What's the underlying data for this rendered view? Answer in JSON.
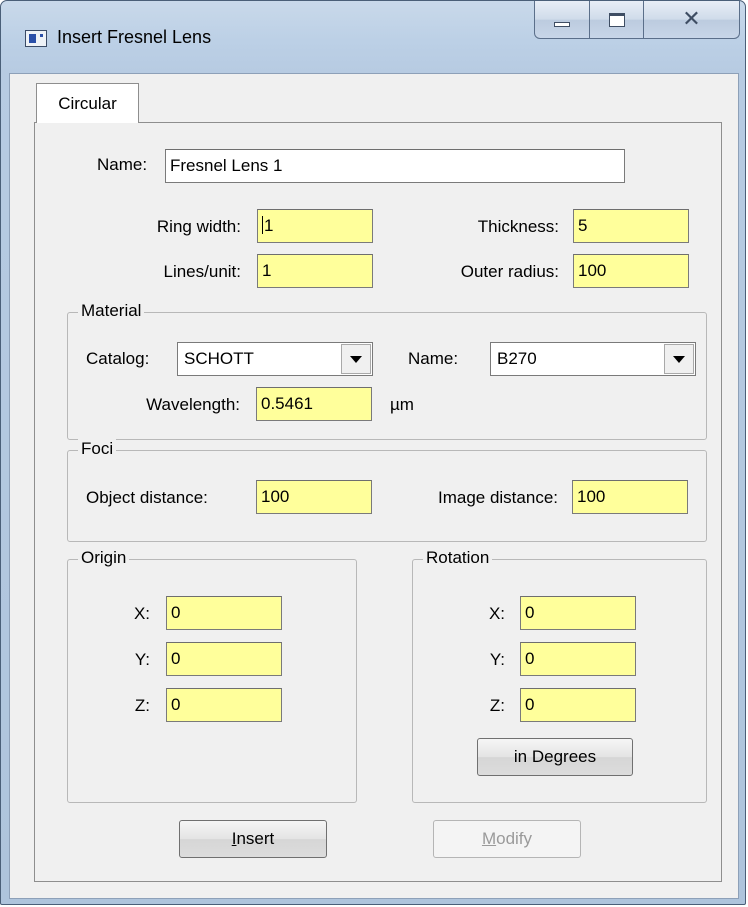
{
  "window": {
    "title": "Insert Fresnel Lens"
  },
  "caption": {
    "minimize_icon": "minimize-icon",
    "maximize_icon": "maximize-icon",
    "close_icon": "close-icon"
  },
  "tabs": [
    {
      "label": "Circular",
      "selected": true
    }
  ],
  "form": {
    "name_label": "Name:",
    "name_value": "Fresnel Lens 1",
    "ring_width_label": "Ring width:",
    "ring_width_value": "1",
    "thickness_label": "Thickness:",
    "thickness_value": "5",
    "lines_unit_label": "Lines/unit:",
    "lines_unit_value": "1",
    "outer_radius_label": "Outer radius:",
    "outer_radius_value": "100"
  },
  "material": {
    "legend": "Material",
    "catalog_label": "Catalog:",
    "catalog_value": "SCHOTT",
    "name_label": "Name:",
    "name_value": "B270",
    "wavelength_label": "Wavelength:",
    "wavelength_value": "0.5461",
    "wavelength_unit": "µm"
  },
  "foci": {
    "legend": "Foci",
    "object_distance_label": "Object distance:",
    "object_distance_value": "100",
    "image_distance_label": "Image distance:",
    "image_distance_value": "100"
  },
  "origin": {
    "legend": "Origin",
    "x_label": "X:",
    "x_value": "0",
    "y_label": "Y:",
    "y_value": "0",
    "z_label": "Z:",
    "z_value": "0"
  },
  "rotation": {
    "legend": "Rotation",
    "x_label": "X:",
    "x_value": "0",
    "y_label": "Y:",
    "y_value": "0",
    "z_label": "Z:",
    "z_value": "0",
    "units_button": "in Degrees"
  },
  "buttons": {
    "insert_access_key": "I",
    "insert_rest": "nsert",
    "modify_access_key": "M",
    "modify_rest": "odify",
    "modify_enabled": false
  },
  "colors": {
    "required_field": "#ffff9b",
    "window_frame": "#bcd0e6",
    "dialog_face": "#f0f0f0"
  }
}
